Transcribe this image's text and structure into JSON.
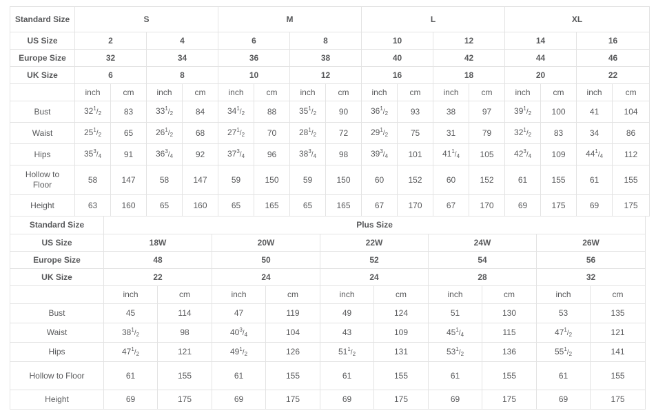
{
  "standard_table": {
    "row_header_labels": {
      "standard_size": "Standard Size",
      "us_size": "US Size",
      "europe_size": "Europe Size",
      "uk_size": "UK Size"
    },
    "size_groups": [
      "S",
      "M",
      "L",
      "XL"
    ],
    "us_sizes": [
      "2",
      "4",
      "6",
      "8",
      "10",
      "12",
      "14",
      "16"
    ],
    "europe_sizes": [
      "32",
      "34",
      "36",
      "38",
      "40",
      "42",
      "44",
      "46"
    ],
    "uk_sizes": [
      "6",
      "8",
      "10",
      "12",
      "16",
      "18",
      "20",
      "22"
    ],
    "unit_labels": [
      "inch",
      "cm",
      "inch",
      "cm",
      "inch",
      "cm",
      "inch",
      "cm",
      "inch",
      "cm",
      "inch",
      "cm",
      "inch",
      "cm",
      "inch",
      "cm"
    ],
    "measurements": [
      {
        "label": "Bust",
        "inch": [
          "32 1/2",
          "33 1/2",
          "34 1/2",
          "35 1/2",
          "36 1/2",
          "38",
          "39 1/2",
          "41"
        ],
        "cm": [
          "83",
          "84",
          "88",
          "90",
          "93",
          "97",
          "100",
          "104"
        ]
      },
      {
        "label": "Waist",
        "inch": [
          "25 1/2",
          "26 1/2",
          "27 1/2",
          "28 1/2",
          "29 1/2",
          "31",
          "32 1/2",
          "34"
        ],
        "cm": [
          "65",
          "68",
          "70",
          "72",
          "75",
          "79",
          "83",
          "86"
        ]
      },
      {
        "label": "Hips",
        "inch": [
          "35 3/4",
          "36 3/4",
          "37 3/4",
          "38 3/4",
          "39 3/4",
          "41 1/4",
          "42 3/4",
          "44 1/4"
        ],
        "cm": [
          "91",
          "92",
          "96",
          "98",
          "101",
          "105",
          "109",
          "112"
        ]
      },
      {
        "label": "Hollow to Floor",
        "label_line1": "Hollow to",
        "label_line2": "Floor",
        "inch": [
          "58",
          "58",
          "59",
          "59",
          "60",
          "60",
          "61",
          "61"
        ],
        "cm": [
          "147",
          "147",
          "150",
          "150",
          "152",
          "152",
          "155",
          "155"
        ]
      },
      {
        "label": "Height",
        "inch": [
          "63",
          "65",
          "65",
          "65",
          "67",
          "67",
          "69",
          "69"
        ],
        "cm": [
          "160",
          "160",
          "165",
          "165",
          "170",
          "170",
          "175",
          "175"
        ]
      }
    ]
  },
  "plus_table": {
    "row_header_labels": {
      "standard_size": "Standard Size",
      "us_size": "US Size",
      "europe_size": "Europe Size",
      "uk_size": "UK Size"
    },
    "group_title": "Plus Size",
    "us_sizes": [
      "18W",
      "20W",
      "22W",
      "24W",
      "26W"
    ],
    "europe_sizes": [
      "48",
      "50",
      "52",
      "54",
      "56"
    ],
    "uk_sizes": [
      "22",
      "24",
      "24",
      "28",
      "32"
    ],
    "unit_labels": [
      "inch",
      "cm",
      "inch",
      "cm",
      "inch",
      "cm",
      "inch",
      "cm",
      "inch",
      "cm"
    ],
    "measurements": [
      {
        "label": "Bust",
        "inch": [
          "45",
          "47",
          "49",
          "51",
          "53"
        ],
        "cm": [
          "114",
          "119",
          "124",
          "130",
          "135"
        ]
      },
      {
        "label": "Waist",
        "inch": [
          "38 1/2",
          "40 3/4",
          "43",
          "45 1/4",
          "47 1/2"
        ],
        "cm": [
          "98",
          "104",
          "109",
          "115",
          "121"
        ]
      },
      {
        "label": "Hips",
        "inch": [
          "47 1/2",
          "49 1/2",
          "51 1/2",
          "53 1/2",
          "55 1/2"
        ],
        "cm": [
          "121",
          "126",
          "131",
          "136",
          "141"
        ]
      },
      {
        "label": "Hollow to Floor",
        "inch": [
          "61",
          "61",
          "61",
          "61",
          "61"
        ],
        "cm": [
          "155",
          "155",
          "155",
          "155",
          "155"
        ]
      },
      {
        "label": "Height",
        "inch": [
          "69",
          "69",
          "69",
          "69",
          "69"
        ],
        "cm": [
          "175",
          "175",
          "175",
          "175",
          "175"
        ]
      }
    ]
  },
  "colors": {
    "header_bg": "#ededed",
    "header_text": "#231f20",
    "body_text": "#58595b",
    "border": "#e3e3e3",
    "page_bg": "#ffffff"
  }
}
